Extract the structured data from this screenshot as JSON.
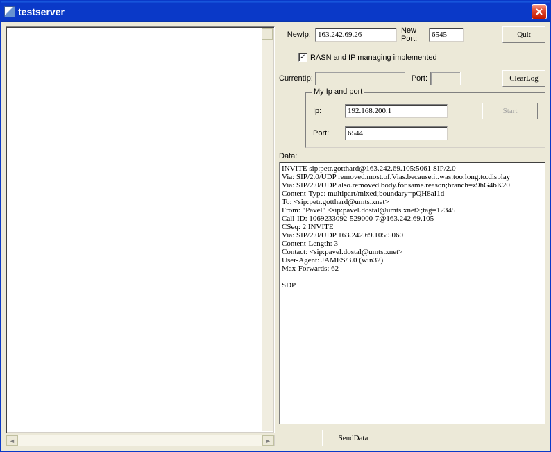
{
  "window": {
    "title": "testserver"
  },
  "buttons": {
    "quit": "Quit",
    "clearlog": "ClearLog",
    "start": "Start",
    "senddata": "SendData"
  },
  "labels": {
    "newip": "NewIp:",
    "newport": "New Port:",
    "rasn": "RASN and IP managing implemented",
    "currentip": "CurrentIp:",
    "port": "Port:",
    "myipport": "My Ip and port",
    "ip": "Ip:",
    "myport": "Port:",
    "data": "Data:"
  },
  "values": {
    "newip": "163.242.69.26",
    "newport": "6545",
    "currentip": "",
    "currentport": "",
    "myip": "192.168.200.1",
    "myport": "6544",
    "rasn_checked": true
  },
  "data_text": "INVITE sip:petr.gotthard@163.242.69.105:5061 SIP/2.0\nVia: SIP/2.0/UDP removed.most.of.Vias.because.it.was.too.long.to.display\nVia: SIP/2.0/UDP also.removed.body.for.same.reason;branch=z9hG4bK20\nContent-Type: multipart/mixed;boundary=pQH8aI1d\nTo: <sip:petr.gotthard@umts.xnet>\nFrom: \"Pavel\" <sip:pavel.dostal@umts.xnet>;tag=12345\nCall-ID: 1069233092-529000-7@163.242.69.105\nCSeq: 2 INVITE\nVia: SIP/2.0/UDP 163.242.69.105:5060\nContent-Length: 3\nContact: <sip:pavel.dostal@umts.xnet>\nUser-Agent: JAMES/3.0 (win32)\nMax-Forwards: 62\n\nSDP"
}
